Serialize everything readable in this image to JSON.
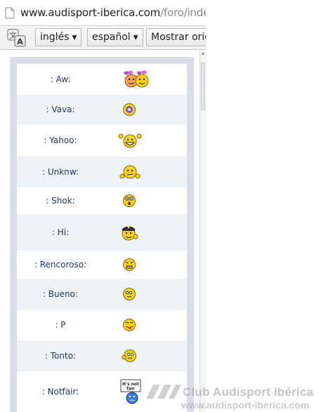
{
  "address_bar": {
    "url_host": "www.audisport-iberica.com",
    "url_path": "/foro/index"
  },
  "translate_bar": {
    "source_language": "inglés",
    "target_language": "español",
    "show_original_label": "Mostrar orig"
  },
  "smilies": [
    {
      "code": ": Aw:",
      "icon": "aw-couple-smiley-icon"
    },
    {
      "code": ": Vava:",
      "icon": "vava-smiley-icon"
    },
    {
      "code": ": Yahoo:",
      "icon": "yahoo-smiley-icon"
    },
    {
      "code": ": Unknw:",
      "icon": "unknw-shrug-smiley-icon"
    },
    {
      "code": ": Shok:",
      "icon": "shok-smiley-icon"
    },
    {
      "code": ": Hi:",
      "icon": "hi-police-smiley-icon"
    },
    {
      "code": ": Rencoroso:",
      "icon": "rencoroso-smiley-icon"
    },
    {
      "code": ": Bueno:",
      "icon": "bueno-smiley-icon"
    },
    {
      "code": ": P",
      "icon": "tongue-smiley-icon"
    },
    {
      "code": ": Tonto:",
      "icon": "tonto-smiley-icon"
    },
    {
      "code": ": Notfair:",
      "icon": "notfair-sign-smiley-icon",
      "sign_text": "It's not fair"
    }
  ],
  "watermark": {
    "title": "Club Audisport Ibérica",
    "url": "www.audisport-iberica.com"
  },
  "colors": {
    "panel_bg": "#d8dde7",
    "row_alt": "#eef3f7",
    "code_text": "#23395a",
    "smiley_yellow": "#f6d21e"
  }
}
